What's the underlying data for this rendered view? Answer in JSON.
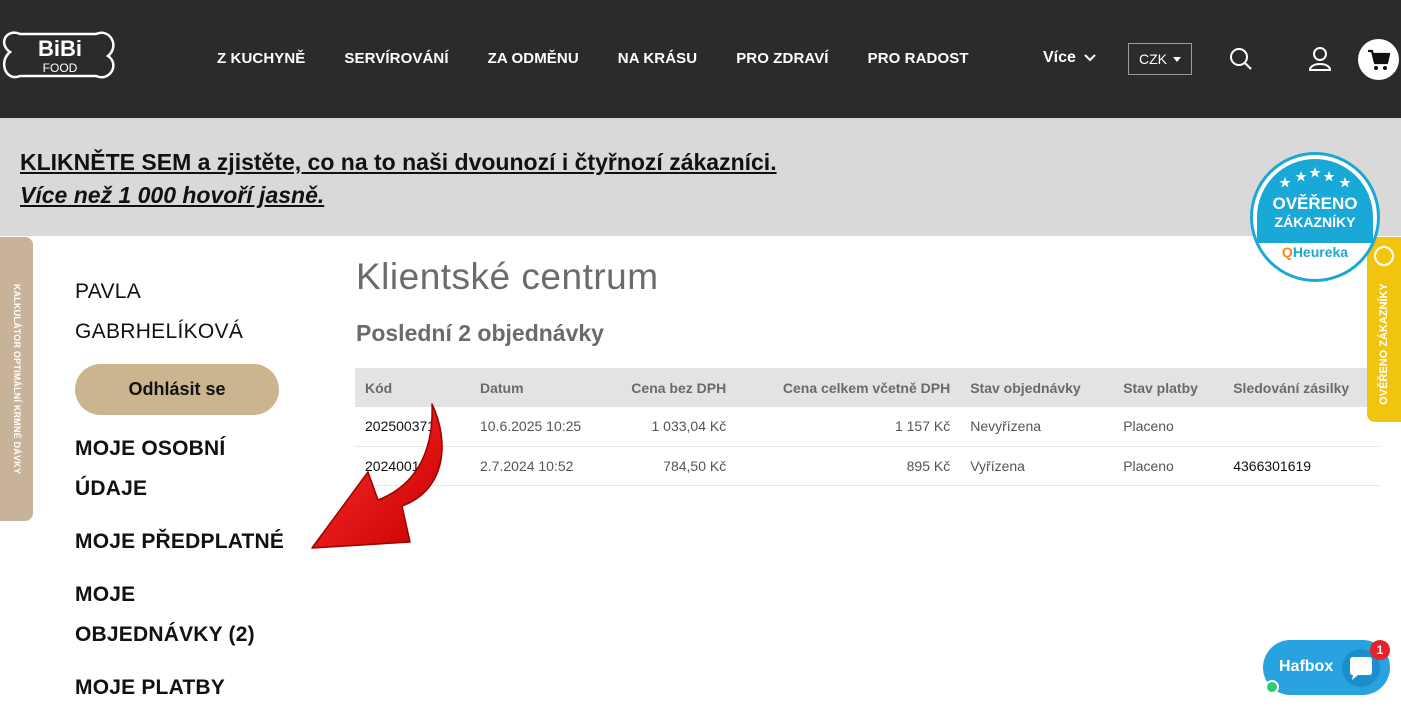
{
  "header": {
    "logo_text_top": "BiBi",
    "logo_text_bottom": "FOOD",
    "nav": [
      "Z KUCHYNĚ",
      "SERVÍROVÁNÍ",
      "ZA ODMĚNU",
      "NA KRÁSU",
      "PRO ZDRAVÍ",
      "PRO RADOST"
    ],
    "more_label": "Více",
    "currency": "CZK",
    "icons": [
      "search-icon",
      "user-icon",
      "cart-icon"
    ]
  },
  "banner": {
    "line1": "KLIKNĚTE SEM a zjistěte, co na to naši dvounozí i čtyřnozí zákazníci.",
    "line2": "Více než 1 000 hovoří jasně."
  },
  "heureka": {
    "line1": "OVĚŘENO",
    "line2": "ZÁKAZNÍKY",
    "brand": "Heureka"
  },
  "side_tabs": {
    "left": "KALKULÁTOR OPTIMÁLNÍ KRMNÉ DÁVKY",
    "right": "OVĚŘENO ZÁKAZNÍKY"
  },
  "sidebar": {
    "user_first": "PAVLA",
    "user_last": "GABRHELÍKOVÁ",
    "logout_label": "Odhlásit se",
    "menu": [
      {
        "line1": "MOJE OSOBNÍ",
        "line2": "ÚDAJE"
      },
      {
        "line1": "MOJE PŘEDPLATNÉ",
        "line2": ""
      },
      {
        "line1": "MOJE",
        "line2": "OBJEDNÁVKY (2)"
      },
      {
        "line1": "MOJE PLATBY",
        "line2": ""
      }
    ]
  },
  "main": {
    "title": "Klientské centrum",
    "section_title": "Poslední 2 objednávky",
    "columns": [
      "Kód",
      "Datum",
      "Cena bez DPH",
      "Cena celkem včetně DPH",
      "Stav objednávky",
      "Stav platby",
      "Sledování zásilky"
    ],
    "rows": [
      {
        "code": "20250037​1",
        "date": "10.6.2025 10:25",
        "net": "1 033,04 Kč",
        "total": "1 157 Kč",
        "order_state": "Nevyřízena",
        "payment_state": "Placeno",
        "tracking": ""
      },
      {
        "code": "20240016​5",
        "date": "2.7.2024 10:52",
        "net": "784,50 Kč",
        "total": "895 Kč",
        "order_state": "Vyřízena",
        "payment_state": "Placeno",
        "tracking": "4366301619"
      }
    ]
  },
  "chat": {
    "label": "Hafbox",
    "unread": "1"
  },
  "colors": {
    "header_bg": "#2b2b2b",
    "banner_bg": "#d9d9d9",
    "logout_bg": "#cbb58f",
    "accent_red": "#e00000",
    "heureka_blue": "#1aa8d6",
    "side_tab_yellow": "#f1c40f",
    "side_tab_tan": "#c8b39a",
    "chat_blue": "#29a3e0"
  }
}
